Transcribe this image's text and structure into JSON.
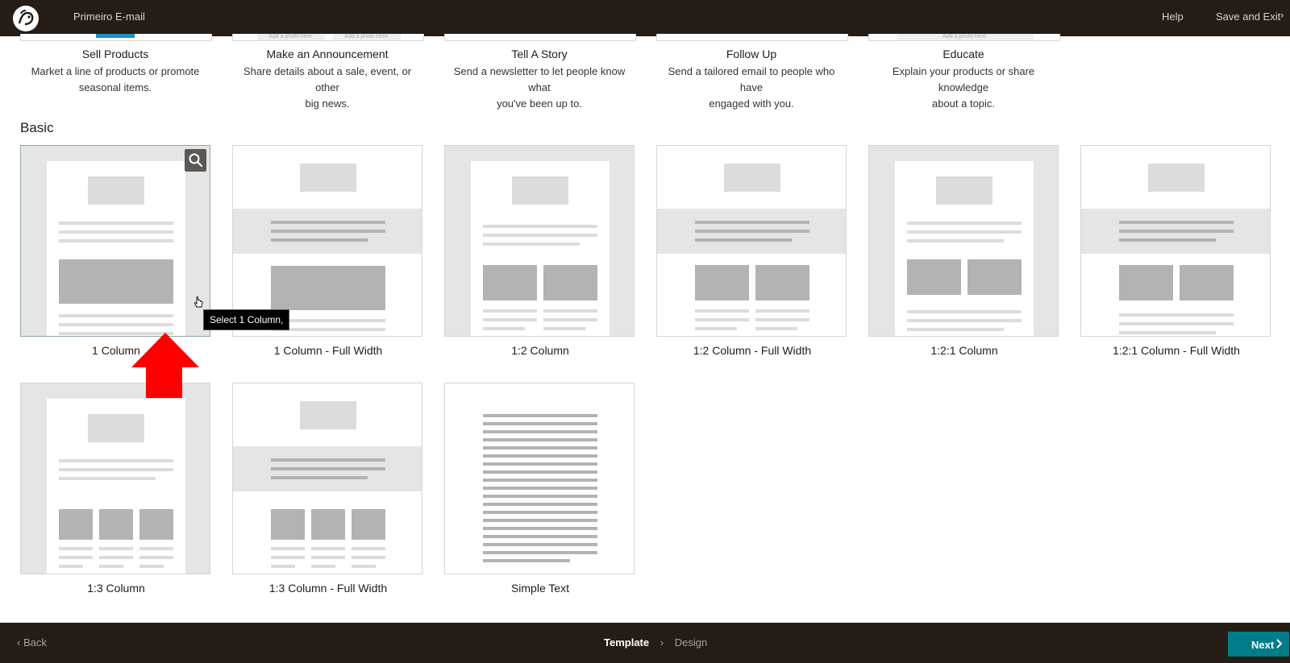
{
  "header": {
    "campaign_title": "Primeiro E-mail",
    "help_label": "Help",
    "save_exit_label": "Save and Exit",
    "save_exit_caret": "›"
  },
  "themed_templates": [
    {
      "name": "Sell Products",
      "desc1": "Market a line of products or promote",
      "desc2": "seasonal items."
    },
    {
      "name": "Make an Announcement",
      "desc1": "Share details about a sale, event, or other",
      "desc2": "big news.",
      "ph1": "Add a photo here.",
      "ph2": "Add a photo here."
    },
    {
      "name": "Tell A Story",
      "desc1": "Send a newsletter to let people know what",
      "desc2": "you've been up to."
    },
    {
      "name": "Follow Up",
      "desc1": "Send a tailored email to people who have",
      "desc2": "engaged with you."
    },
    {
      "name": "Educate",
      "desc1": "Explain your products or share knowledge",
      "desc2": "about a topic.",
      "ph1": "Add a photo here."
    }
  ],
  "basic": {
    "section_title": "Basic",
    "layouts": [
      {
        "label": "1 Column"
      },
      {
        "label": "1 Column - Full Width"
      },
      {
        "label": "1:2 Column"
      },
      {
        "label": "1:2 Column - Full Width"
      },
      {
        "label": "1:2:1 Column"
      },
      {
        "label": "1:2:1 Column - Full Width"
      },
      {
        "label": "1:3 Column"
      },
      {
        "label": "1:3 Column - Full Width"
      },
      {
        "label": "Simple Text"
      }
    ],
    "tooltip": "Select 1 Column,"
  },
  "footer": {
    "back_label": "Back",
    "back_caret": "‹",
    "steps": [
      "Template",
      "Design"
    ],
    "step_sep": "›",
    "next_label": "Next"
  },
  "colors": {
    "topbar": "#241c15",
    "accent_next": "#007c89",
    "annotation_arrow": "#ff0000"
  }
}
